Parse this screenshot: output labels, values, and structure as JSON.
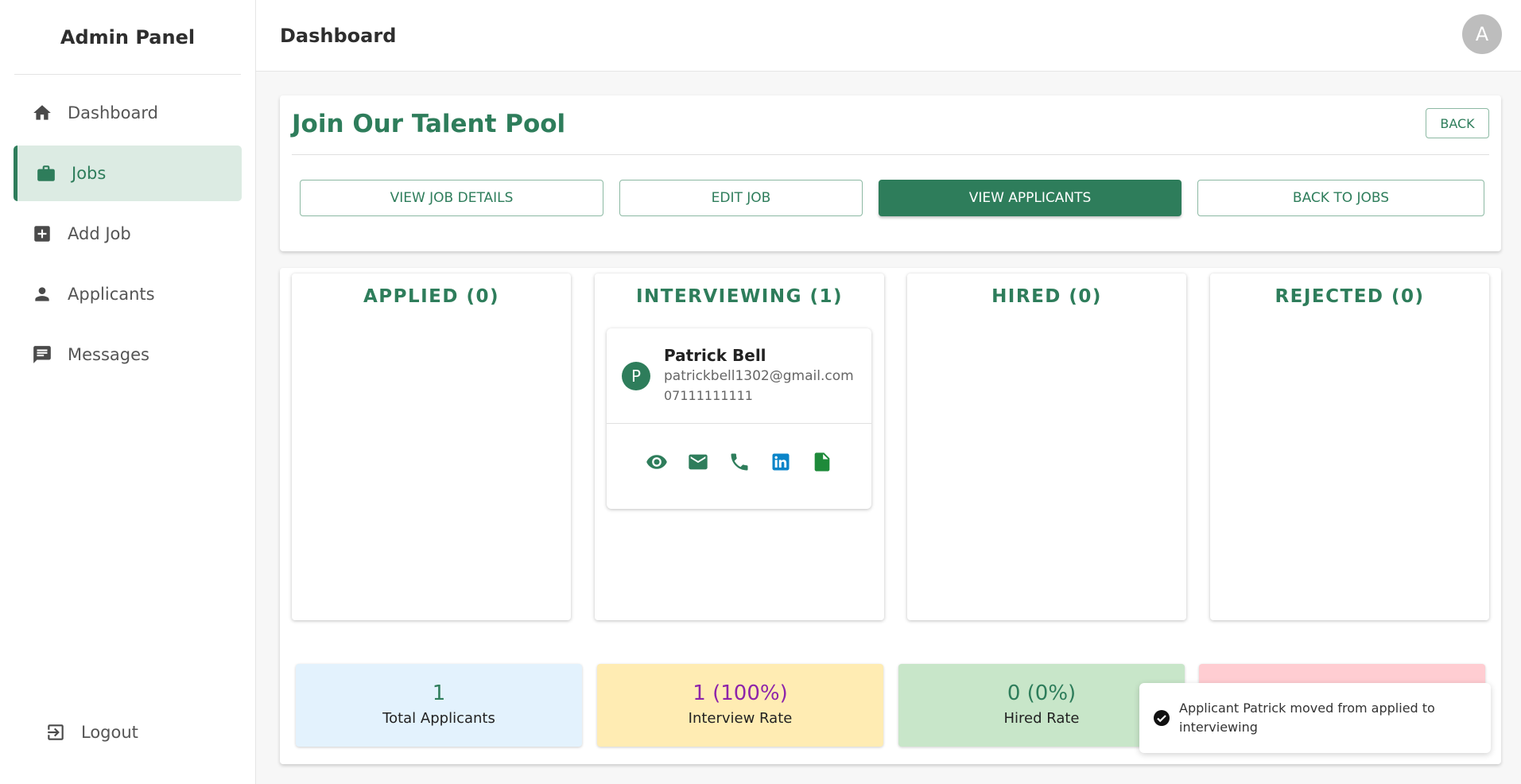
{
  "sidebar": {
    "brand": "Admin Panel",
    "items": [
      {
        "label": "Dashboard",
        "icon": "home-icon"
      },
      {
        "label": "Jobs",
        "icon": "briefcase-icon",
        "active": true
      },
      {
        "label": "Add Job",
        "icon": "add-box-icon"
      },
      {
        "label": "Applicants",
        "icon": "person-icon"
      },
      {
        "label": "Messages",
        "icon": "chat-icon"
      }
    ],
    "logout": {
      "label": "Logout",
      "icon": "logout-icon"
    }
  },
  "topbar": {
    "title": "Dashboard",
    "avatar_initial": "A"
  },
  "job": {
    "title": "Join Our Talent Pool",
    "back_label": "BACK",
    "actions": [
      {
        "label": "VIEW JOB DETAILS"
      },
      {
        "label": "EDIT JOB"
      },
      {
        "label": "VIEW APPLICANTS",
        "active": true
      },
      {
        "label": "BACK TO JOBS"
      }
    ]
  },
  "columns": [
    {
      "title": "APPLIED (0)"
    },
    {
      "title": "INTERVIEWING (1)"
    },
    {
      "title": "HIRED (0)"
    },
    {
      "title": "REJECTED (0)"
    }
  ],
  "applicant": {
    "initial": "P",
    "name": "Patrick Bell",
    "email": "patrickbell1302@gmail.com",
    "phone": "07111111111",
    "action_icons": [
      "eye-icon",
      "email-icon",
      "phone-icon",
      "linkedin-icon",
      "document-icon"
    ]
  },
  "stats": [
    {
      "value": "1",
      "label": "Total Applicants",
      "bg": "#e3f2fd",
      "color": "#2e7d5b"
    },
    {
      "value": "1 (100%)",
      "label": "Interview Rate",
      "bg": "#ffecb3",
      "color": "#8e24aa"
    },
    {
      "value": "0 (0%)",
      "label": "Hired Rate",
      "bg": "#c8e6c9",
      "color": "#2e7d5b"
    },
    {
      "value": "",
      "label": "",
      "bg": "#ffcdd2",
      "color": "#c62828"
    }
  ],
  "toast": {
    "message": "Applicant Patrick moved from applied to interviewing"
  },
  "colors": {
    "accent": "#2e7d5b"
  }
}
